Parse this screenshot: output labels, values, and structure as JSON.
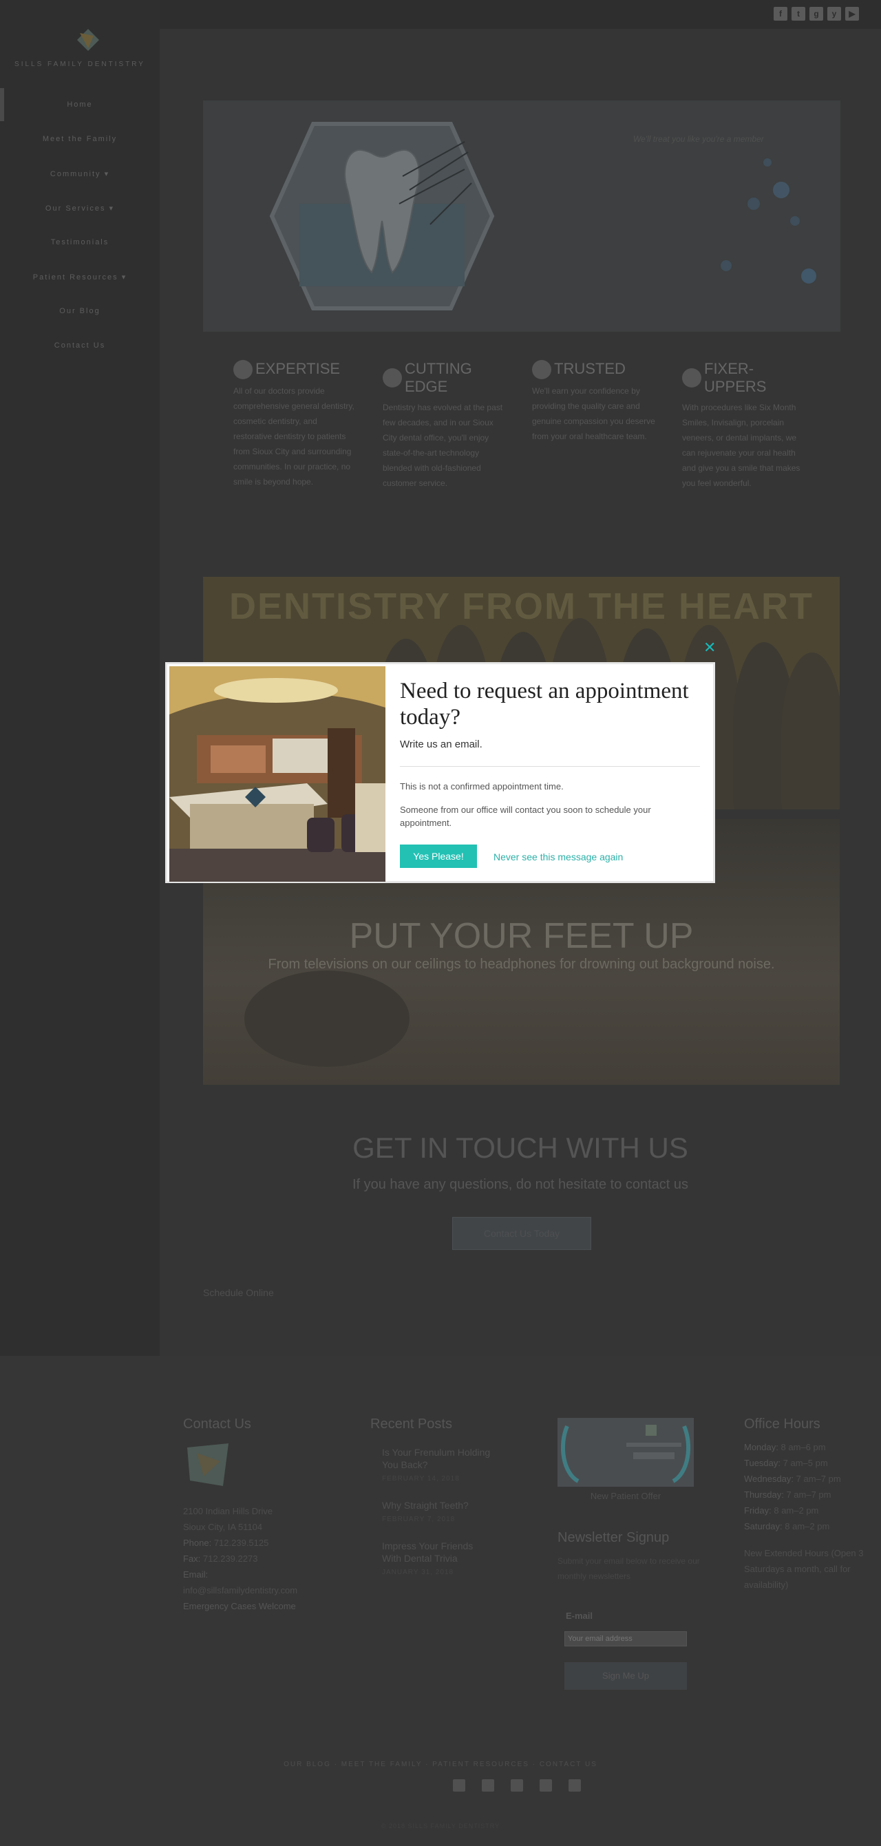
{
  "header": {
    "social_icons": [
      "facebook-icon",
      "twitter-icon",
      "google-plus-icon",
      "yelp-icon",
      "youtube-icon"
    ]
  },
  "sidebar": {
    "logo_text": "SILLS FAMILY DENTISTRY",
    "items": [
      {
        "label": "Home"
      },
      {
        "label": "Meet the Family"
      },
      {
        "label": "Community ▾"
      },
      {
        "label": "Our Services ▾"
      },
      {
        "label": "Testimonials"
      },
      {
        "label": "Patient Resources ▾"
      },
      {
        "label": "Our Blog"
      },
      {
        "label": "Contact Us"
      }
    ]
  },
  "hero": {
    "tagline": "We'll treat you like you're a member"
  },
  "features": [
    {
      "title": "EXPERTISE",
      "body": "All of our doctors provide comprehensive general dentistry, cosmetic dentistry, and restorative dentistry to patients from Sioux City and surrounding communities. In our practice, no smile is beyond hope."
    },
    {
      "title": "CUTTING EDGE",
      "body": "Dentistry has evolved at the past few decades, and in our Sioux City dental office, you'll enjoy state-of-the-art technology blended with old-fashioned customer service."
    },
    {
      "title": "TRUSTED",
      "body": "We'll earn your confidence by providing the quality care and genuine compassion you deserve from your oral healthcare team."
    },
    {
      "title": "FIXER-UPPERS",
      "body": "With procedures like Six Month Smiles, Invisalign, porcelain veneers, or dental implants, we can rejuvenate your oral health and give you a smile that makes you feel wonderful."
    }
  ],
  "banner1": {
    "title": "DENTISTRY FROM THE HEART"
  },
  "banner2": {
    "title": "PUT YOUR FEET UP",
    "subtitle": "From televisions on our ceilings to headphones for drowning out background noise."
  },
  "contact_section": {
    "title": "GET IN TOUCH WITH US",
    "subtitle": "If you have any questions, do not hesitate to contact us",
    "button": "Contact Us Today",
    "schedule_link": "Schedule Online"
  },
  "footer": {
    "contact": {
      "heading": "Contact Us",
      "address1": "2100 Indian Hills Drive",
      "address2": "Sioux City, IA 51104",
      "phone_label": "Phone:",
      "phone": "712.239.5125",
      "fax_label": "Fax:",
      "fax": "712.239.2273",
      "email_label": "Email:",
      "email": "info@sillsfamilydentistry.com",
      "emergency": "Emergency Cases Welcome"
    },
    "posts": {
      "heading": "Recent Posts",
      "items": [
        {
          "title": "Is Your Frenulum Holding You Back?",
          "date": "FEBRUARY 14, 2018"
        },
        {
          "title": "Why Straight Teeth?",
          "date": "FEBRUARY 7, 2018"
        },
        {
          "title": "Impress Your Friends With Dental Trivia",
          "date": "JANUARY 31, 2018"
        }
      ]
    },
    "newsletter": {
      "image_caption": "New Patient Offer",
      "heading": "Newsletter Signup",
      "text": "Submit your email below to receive our monthly newsletters",
      "email_label": "E-mail",
      "email_placeholder": "Your email address",
      "button": "Sign Me Up"
    },
    "hours": {
      "heading": "Office Hours",
      "rows": [
        {
          "day": "Monday:",
          "time": "8 am–6 pm"
        },
        {
          "day": "Tuesday:",
          "time": "7 am–5 pm"
        },
        {
          "day": "Wednesday:",
          "time": "7 am–7 pm"
        },
        {
          "day": "Thursday:",
          "time": "7 am–7 pm"
        },
        {
          "day": "Friday:",
          "time": "8 am–2 pm"
        },
        {
          "day": "Saturday:",
          "time": "8 am–2 pm"
        }
      ],
      "note": "New Extended Hours (Open 3 Saturdays a month, call for availability)"
    },
    "links": "OUR BLOG  ·  MEET THE FAMILY  ·  PATIENT RESOURCES  ·  CONTACT US",
    "copyright": "© 2018 SILLS FAMILY DENTISTRY"
  },
  "modal": {
    "title": "Need to request an appointment today?",
    "subtitle": "Write us an email.",
    "note1": "This is not a confirmed appointment time.",
    "note2": "Someone from our office will contact you soon to schedule your appointment.",
    "yes_button": "Yes Please!",
    "never_link": "Never see this message again",
    "close_symbol": "✕"
  },
  "colors": {
    "accent": "#22c1b4",
    "link": "#2bb0a8"
  }
}
